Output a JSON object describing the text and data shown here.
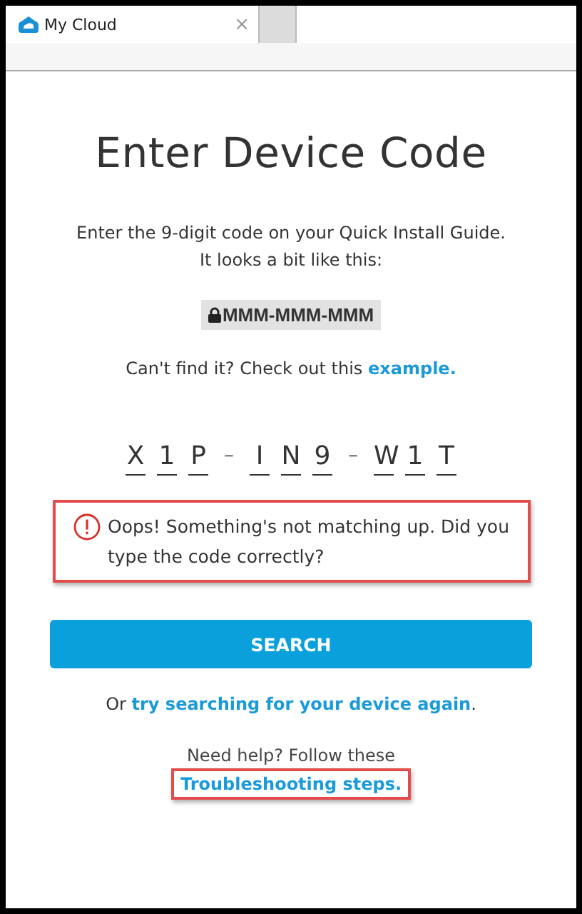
{
  "browser": {
    "tab_title": "My Cloud",
    "close_glyph": "×"
  },
  "page": {
    "title": "Enter Device Code",
    "instruction": "Enter the 9-digit code on your Quick Install Guide. It looks a bit like this:",
    "code_sample": "MMM-MMM-MMM",
    "hint_text": "Can't find it? Check out this ",
    "hint_link": "example.",
    "code_groups": [
      [
        "X",
        "1",
        "P"
      ],
      [
        "I",
        "N",
        "9"
      ],
      [
        "W",
        "1",
        "T"
      ]
    ],
    "code_separator": "–",
    "error": {
      "message": "Oops! Something's not matching up. Did you type the code correctly?",
      "highlighted": true
    },
    "search_button": "SEARCH",
    "retry_prefix": "Or ",
    "retry_link": "try searching for your device again",
    "retry_suffix": ".",
    "help_text": "Need help? Follow these",
    "help_link": {
      "label": "Troubleshooting steps.",
      "highlighted": true
    }
  }
}
